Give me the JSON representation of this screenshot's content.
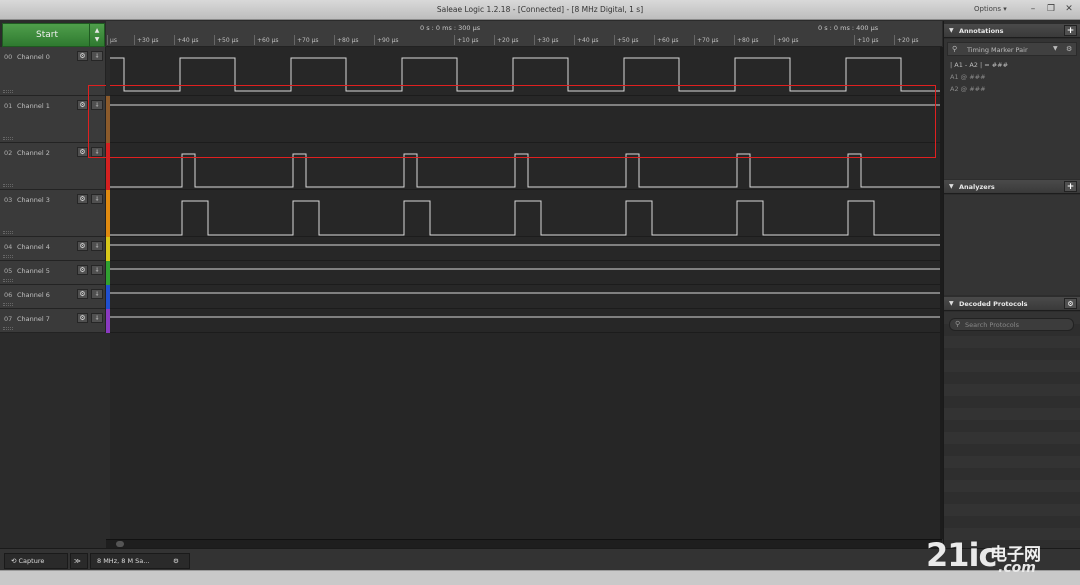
{
  "window": {
    "title": "Saleae Logic 1.2.18 - [Connected] - [8 MHz Digital, 1 s]",
    "options_label": "Options ▾"
  },
  "capture": {
    "start_label": "Start"
  },
  "timeline": {
    "left_time": "0 s : 0 ms : 300 μs",
    "right_time": "0 s : 0 ms : 400 μs",
    "ticks_left": [
      "μs",
      "+30 μs",
      "+40 μs",
      "+50 μs",
      "+60 μs",
      "+70 μs",
      "+80 μs",
      "+90 μs"
    ],
    "ticks_mid": [
      "+10 μs",
      "+20 μs",
      "+30 μs",
      "+40 μs",
      "+50 μs",
      "+60 μs",
      "+70 μs",
      "+80 μs",
      "+90 μs"
    ],
    "ticks_right": [
      "+10 μs",
      "+20 μs"
    ]
  },
  "channels": [
    {
      "num": "00",
      "name": "Channel 0",
      "color": "#2b2b2b"
    },
    {
      "num": "01",
      "name": "Channel 1",
      "color": "#8b5a2b"
    },
    {
      "num": "02",
      "name": "Channel 2",
      "color": "#d42020"
    },
    {
      "num": "03",
      "name": "Channel 3",
      "color": "#e08a10"
    },
    {
      "num": "04",
      "name": "Channel 4",
      "color": "#d8c81a"
    },
    {
      "num": "05",
      "name": "Channel 5",
      "color": "#30a030"
    },
    {
      "num": "06",
      "name": "Channel 6",
      "color": "#2050d0"
    },
    {
      "num": "07",
      "name": "Channel 7",
      "color": "#8a3ac0"
    }
  ],
  "annotations": {
    "header": "Annotations",
    "timing_marker": "Timing Marker Pair",
    "a1": "A1",
    "a2": "A2",
    "pair_text": "| A1 - A2 | = ###",
    "a1_text": "A1  @  ###",
    "a2_text": "A2  @  ###"
  },
  "analyzers": {
    "header": "Analyzers"
  },
  "decoded_protocols": {
    "header": "Decoded Protocols",
    "search_placeholder": "Search Protocols"
  },
  "bottom": {
    "capture_tab": "Capture",
    "session_tab": "8 MHz, 8 M Sa..."
  },
  "watermark": {
    "big": "21ic",
    "cn": "电子网",
    "domain": ".com"
  },
  "colors": {
    "start_green": "#3e8e3c",
    "highlight_red": "#e02020",
    "waveform": "#d8d8d8"
  }
}
